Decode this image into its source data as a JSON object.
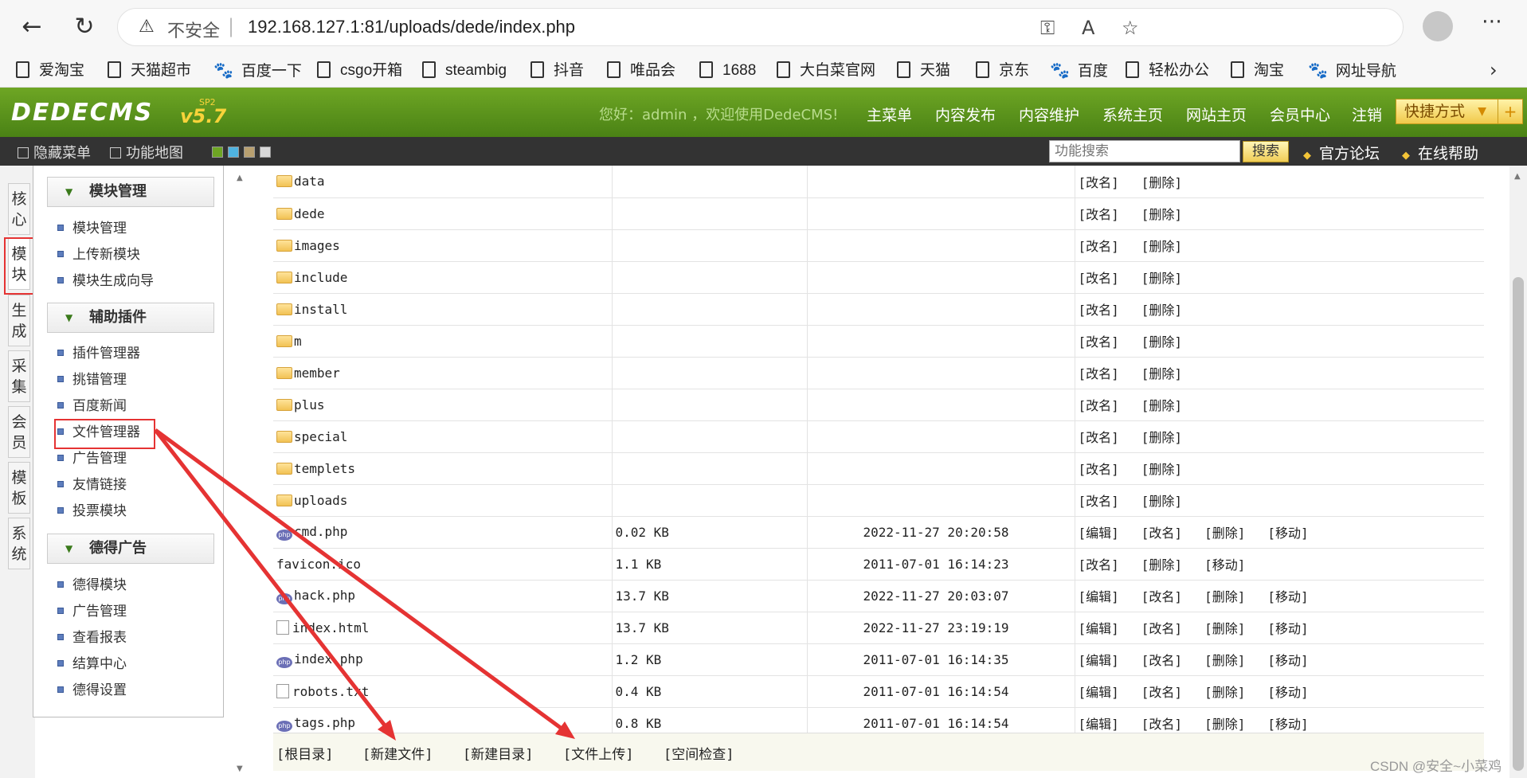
{
  "browser": {
    "insecure_label": "不安全",
    "url": "192.168.127.1:81/uploads/dede/index.php",
    "bookmarks": [
      "爱淘宝",
      "天猫超市",
      "百度一下",
      "csgo开箱",
      "steambig",
      "抖音",
      "唯品会",
      "1688",
      "大白菜官网",
      "天猫",
      "京东",
      "百度",
      "轻松办公",
      "淘宝",
      "网址导航"
    ]
  },
  "header": {
    "logo": "DEDECMS",
    "version": "v5.7",
    "sp": "SP2",
    "welcome": "您好：admin ，欢迎使用DedeCMS!",
    "nav": [
      "主菜单",
      "内容发布",
      "内容维护",
      "系统主页",
      "网站主页",
      "会员中心",
      "注销"
    ],
    "shortcut": "快捷方式"
  },
  "toolbar": {
    "hide_menu": "隐藏菜单",
    "func_map": "功能地图",
    "search_placeholder": "功能搜索",
    "search_btn": "搜索",
    "forum": "官方论坛",
    "help": "在线帮助"
  },
  "side_tabs": [
    "核心",
    "模块",
    "生成",
    "采集",
    "会员",
    "模板",
    "系统"
  ],
  "menu": {
    "group1": {
      "title": "模块管理",
      "items": [
        "模块管理",
        "上传新模块",
        "模块生成向导"
      ]
    },
    "group2": {
      "title": "辅助插件",
      "items": [
        "插件管理器",
        "挑错管理",
        "百度新闻",
        "文件管理器",
        "广告管理",
        "友情链接",
        "投票模块"
      ]
    },
    "group3": {
      "title": "德得广告",
      "items": [
        "德得模块",
        "广告管理",
        "查看报表",
        "结算中心",
        "德得设置"
      ]
    }
  },
  "files": [
    {
      "name": "data",
      "type": "folder",
      "size": "",
      "date": "",
      "actions": [
        "[改名]",
        "[删除]"
      ]
    },
    {
      "name": "dede",
      "type": "folder",
      "size": "",
      "date": "",
      "actions": [
        "[改名]",
        "[删除]"
      ]
    },
    {
      "name": "images",
      "type": "folder",
      "size": "",
      "date": "",
      "actions": [
        "[改名]",
        "[删除]"
      ]
    },
    {
      "name": "include",
      "type": "folder",
      "size": "",
      "date": "",
      "actions": [
        "[改名]",
        "[删除]"
      ]
    },
    {
      "name": "install",
      "type": "folder",
      "size": "",
      "date": "",
      "actions": [
        "[改名]",
        "[删除]"
      ]
    },
    {
      "name": "m",
      "type": "folder",
      "size": "",
      "date": "",
      "actions": [
        "[改名]",
        "[删除]"
      ]
    },
    {
      "name": "member",
      "type": "folder",
      "size": "",
      "date": "",
      "actions": [
        "[改名]",
        "[删除]"
      ]
    },
    {
      "name": "plus",
      "type": "folder",
      "size": "",
      "date": "",
      "actions": [
        "[改名]",
        "[删除]"
      ]
    },
    {
      "name": "special",
      "type": "folder",
      "size": "",
      "date": "",
      "actions": [
        "[改名]",
        "[删除]"
      ]
    },
    {
      "name": "templets",
      "type": "folder",
      "size": "",
      "date": "",
      "actions": [
        "[改名]",
        "[删除]"
      ]
    },
    {
      "name": "uploads",
      "type": "folder",
      "size": "",
      "date": "",
      "actions": [
        "[改名]",
        "[删除]"
      ]
    },
    {
      "name": "cmd.php",
      "type": "php",
      "size": "0.02 KB",
      "date": "2022-11-27 20:20:58",
      "actions": [
        "[编辑]",
        "[改名]",
        "[删除]",
        "[移动]"
      ]
    },
    {
      "name": "favicon.ico",
      "type": "plain",
      "size": "1.1 KB",
      "date": "2011-07-01 16:14:23",
      "actions": [
        "[改名]",
        "[删除]",
        "[移动]"
      ]
    },
    {
      "name": "hack.php",
      "type": "php",
      "size": "13.7 KB",
      "date": "2022-11-27 20:03:07",
      "actions": [
        "[编辑]",
        "[改名]",
        "[删除]",
        "[移动]"
      ]
    },
    {
      "name": "index.html",
      "type": "file",
      "size": "13.7 KB",
      "date": "2022-11-27 23:19:19",
      "actions": [
        "[编辑]",
        "[改名]",
        "[删除]",
        "[移动]"
      ]
    },
    {
      "name": "index.php",
      "type": "php",
      "size": "1.2 KB",
      "date": "2011-07-01 16:14:35",
      "actions": [
        "[编辑]",
        "[改名]",
        "[删除]",
        "[移动]"
      ]
    },
    {
      "name": "robots.txt",
      "type": "file",
      "size": "0.4 KB",
      "date": "2011-07-01 16:14:54",
      "actions": [
        "[编辑]",
        "[改名]",
        "[删除]",
        "[移动]"
      ]
    },
    {
      "name": "tags.php",
      "type": "php",
      "size": "0.8 KB",
      "date": "2011-07-01 16:14:54",
      "actions": [
        "[编辑]",
        "[改名]",
        "[删除]",
        "[移动]"
      ]
    }
  ],
  "footer_links": [
    "[根目录]",
    "[新建文件]",
    "[新建目录]",
    "[文件上传]",
    "[空间检查]"
  ],
  "watermark": "CSDN @安全~小菜鸡",
  "colors": {
    "header_green": "#5d9a1d",
    "annotation_red": "#e53333"
  }
}
